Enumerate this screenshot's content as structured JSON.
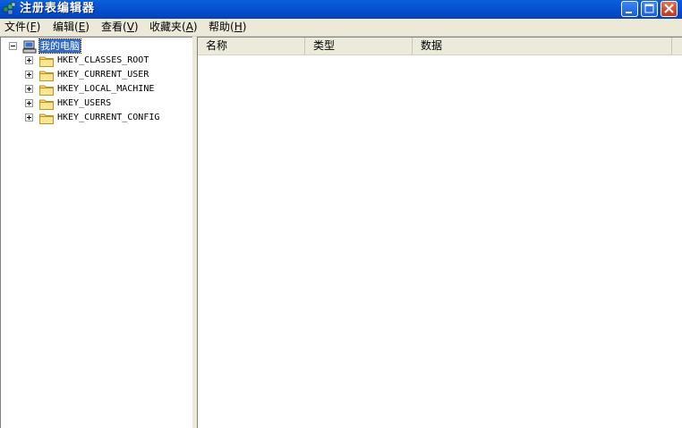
{
  "window": {
    "title": "注册表编辑器",
    "controls": {
      "minimize_icon": "minimize-icon",
      "maximize_icon": "maximize-icon",
      "close_icon": "close-icon"
    }
  },
  "menu": [
    {
      "label": "文件",
      "open": "(",
      "key": "F",
      "close": ")"
    },
    {
      "label": "编辑",
      "open": "(",
      "key": "E",
      "close": ")"
    },
    {
      "label": "查看",
      "open": "(",
      "key": "V",
      "close": ")"
    },
    {
      "label": "收藏夹",
      "open": "(",
      "key": "A",
      "close": ")"
    },
    {
      "label": "帮助",
      "open": "(",
      "key": "H",
      "close": ")"
    }
  ],
  "tree": {
    "root": {
      "label": "我的电脑",
      "icon": "computer-icon",
      "expanded": true
    },
    "keys": [
      {
        "label": "HKEY_CLASSES_ROOT",
        "icon": "folder-icon"
      },
      {
        "label": "HKEY_CURRENT_USER",
        "icon": "folder-icon"
      },
      {
        "label": "HKEY_LOCAL_MACHINE",
        "icon": "folder-icon"
      },
      {
        "label": "HKEY_USERS",
        "icon": "folder-icon"
      },
      {
        "label": "HKEY_CURRENT_CONFIG",
        "icon": "folder-icon"
      }
    ]
  },
  "list": {
    "columns": [
      "名称",
      "类型",
      "数据"
    ],
    "rows": []
  },
  "colors": {
    "title_bar": "#0756d6",
    "selection": "#316ac5",
    "close_button": "#c0391a"
  }
}
